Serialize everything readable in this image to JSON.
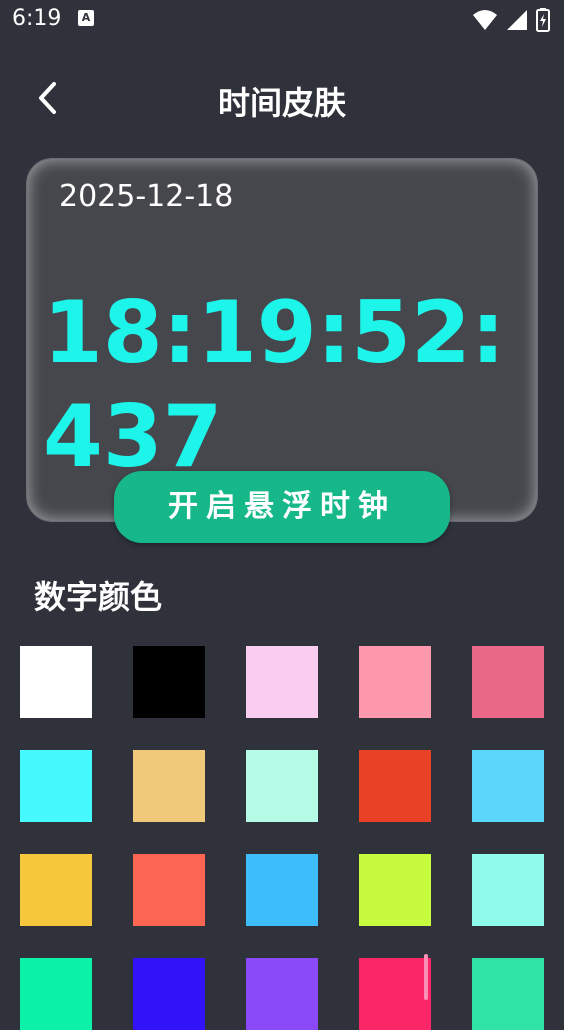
{
  "status_bar": {
    "time": "6:19",
    "notification_icon": "A"
  },
  "header": {
    "title": "时间皮肤"
  },
  "preview": {
    "date": "2025-12-18",
    "time": "18:19:52:437",
    "time_color": "#1ef5ea",
    "float_button_label": "开启悬浮时钟"
  },
  "digit_color_section": {
    "title": "数字颜色",
    "colors": [
      "#ffffff",
      "#000000",
      "#f9cdef",
      "#fd98ad",
      "#e96888",
      "#45f9fe",
      "#f0ca7a",
      "#b6fbe6",
      "#e84125",
      "#5ad6fb",
      "#f5c73a",
      "#fd6553",
      "#3dbefb",
      "#c7fc3e",
      "#8ffbeb",
      "#0bf1a7",
      "#3213f9",
      "#8a4af9",
      "#fb2668",
      "#2fe3a7"
    ]
  }
}
